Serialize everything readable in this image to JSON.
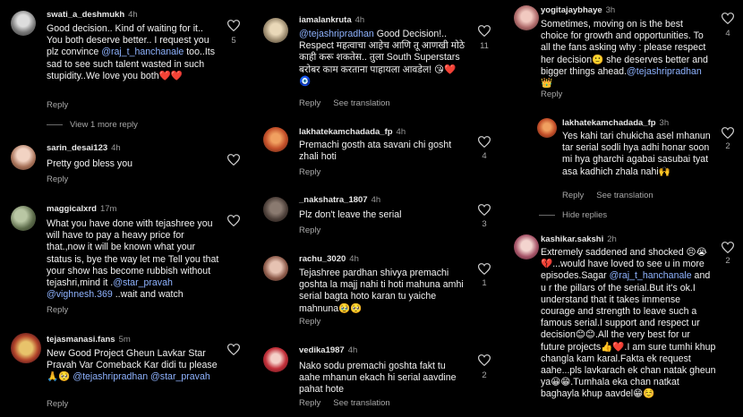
{
  "reply_label": "Reply",
  "see_translation_label": "See translation",
  "view_more_replies": "View 1 more reply",
  "hide_replies": "Hide replies",
  "columns": {
    "col1": [
      {
        "user": "swati_a_deshmukh",
        "time": "4h",
        "text": "Good decision.. Kind of waiting for it.. You both deserve better.. I request you plz convince ",
        "mention": "@raj_t_hanchanale",
        "text2": " too..Its sad to see such talent wasted in such stupidity..We love you both❤️❤️",
        "likes": "5"
      },
      {
        "user": "sarin_desai123",
        "time": "4h",
        "text": "Pretty god bless you",
        "likes": ""
      },
      {
        "user": "maggicalxrd",
        "time": "17m",
        "text": "What you have done with tejashree you will have to pay a heavy price for that.,now it will be known what your status is, bye the way let me Tell you that your show has become rubbish without tejashri,mind it .",
        "mention": "@star_pravah @vighnesh.369",
        "text2": " ..wait and watch",
        "likes": ""
      },
      {
        "user": "tejasmanasi.fans",
        "time": "5m",
        "text": "New Good Project Gheun Lavkar Star Pravah Var Comeback Kar didi tu please 🙏🥺 ",
        "mention": "@tejashripradhan @star_pravah",
        "text2": "",
        "likes": ""
      }
    ],
    "col2": [
      {
        "user": "iamalankruta",
        "time": "4h",
        "mention": "@tejashripradhan",
        "text": " Good Decision!.. Respect महत्वाचा आहेच आणि तू आणखी मोठे काही करू शकतेस.. तुला South Superstars बरोबर काम करताना पाहायला आवडेल! 😘❤️🧿",
        "likes": "11"
      },
      {
        "user": "lakhatekamchadada_fp",
        "time": "4h",
        "text": "Premachi gosth ata savani chi gosht zhali hoti",
        "likes": "4"
      },
      {
        "user": "_nakshatra_1807",
        "time": "4h",
        "text": "Plz don't leave the serial",
        "likes": "3"
      },
      {
        "user": "rachu_3020",
        "time": "4h",
        "text": "Tejashree pardhan shivya premachi goshta la majj nahi ti hoti mahuna amhi serial bagta hoto karan tu yaiche mahnuna🥹🥺",
        "likes": "1"
      },
      {
        "user": "vedika1987",
        "time": "4h",
        "text": "Nako sodu premachi goshta fakt tu aahe mhanun ekach hi serial aavdine pahat hote",
        "likes": "2"
      }
    ],
    "col3": [
      {
        "user": "yogitajaybhaye",
        "time": "3h",
        "text": "Sometimes, moving on is the best choice for growth and opportunities. To all the fans asking why : please respect her decision🙂 she deserves better and bigger things ahead.",
        "mention": "@tejashripradhan",
        "text2": " 👑",
        "likes": "4"
      },
      {
        "user": "lakhatekamchadada_fp",
        "time": "3h",
        "text": "Yes kahi tari chukicha asel mhanun tar serial sodli hya adhi honar soon mi hya gharchi agabai sasubai tyat asa kadhich zhala nahi🙌",
        "likes": "2"
      },
      {
        "user": "kashikar.sakshi",
        "time": "2h",
        "text": "Extremely saddened and shocked 😣😭💔...would have loved to see u in more episodes.Sagar ",
        "mention": "@raj_t_hanchanale",
        "text2": " and u r the pillars of the serial.But it's ok.I understand that it takes immense courage and strength to leave such a famous serial.I support and respect ur decision😊😊.All the very best for ur future projects👍❤️.I am sure tumhi khup changla kam karal.Fakta ek request aahe...pls lavkarach ek chan natak gheun ya😀😁.Tumhala eka chan natkat baghayla khup aavdel😁☺️",
        "likes": "2"
      }
    ]
  }
}
